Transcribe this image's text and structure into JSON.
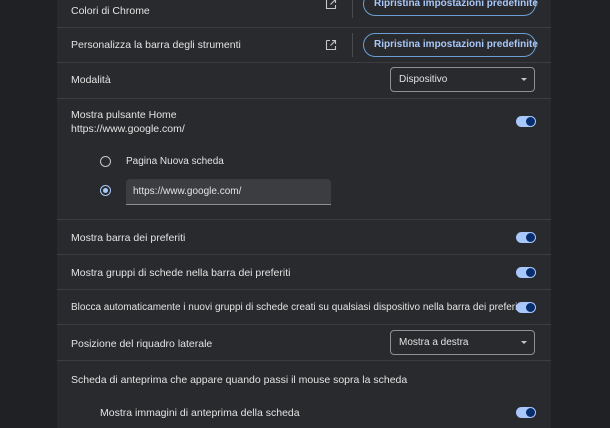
{
  "appearance": {
    "chrome_colors": {
      "label": "Colori di Chrome",
      "reset_label": "Ripristina impostazioni predefinite"
    },
    "toolbar": {
      "label": "Personalizza la barra degli strumenti",
      "reset_label": "Ripristina impostazioni predefinite"
    },
    "mode": {
      "label": "Modalità",
      "selected": "Dispositivo"
    },
    "home_button": {
      "label": "Mostra pulsante Home",
      "sublabel": "https://www.google.com/",
      "enabled": true,
      "options": [
        {
          "label": "Pagina Nuova scheda",
          "selected": false
        },
        {
          "value": "https://www.google.com/",
          "selected": true
        }
      ]
    },
    "bookmarks_bar": {
      "label": "Mostra barra dei preferiti",
      "enabled": true
    },
    "tab_groups_bookmarks": {
      "label": "Mostra gruppi di schede nella barra dei preferiti",
      "enabled": true
    },
    "auto_pin_groups": {
      "label": "Blocca automaticamente i nuovi gruppi di schede creati su qualsiasi dispositivo nella barra dei preferiti",
      "enabled": true
    },
    "side_panel": {
      "label": "Posizione del riquadro laterale",
      "selected": "Mostra a destra"
    },
    "hover_card": {
      "label": "Scheda di anteprima che appare quando passi il mouse sopra la scheda"
    },
    "hover_images": {
      "label": "Mostra immagini di anteprima della scheda",
      "enabled": true
    }
  },
  "colors": {
    "accent": "#a8c7fa",
    "panel_bg": "#292a2d",
    "page_bg": "#202124"
  },
  "icons": {
    "open_external": "open-in-new-icon",
    "dropdown": "arrow-drop-down-icon"
  }
}
